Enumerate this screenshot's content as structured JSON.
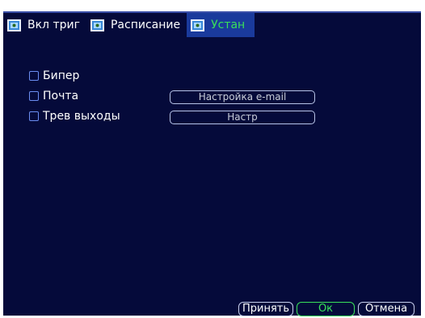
{
  "tabs": [
    {
      "label": "Вкл триг",
      "active": false,
      "icon": "settings-tab-icon"
    },
    {
      "label": "Расписание",
      "active": false,
      "icon": "schedule-tab-icon"
    },
    {
      "label": "Устан",
      "active": true,
      "icon": "setup-tab-icon"
    }
  ],
  "options": {
    "beeper": {
      "label": "Бипер",
      "checked": false
    },
    "mail": {
      "label": "Почта",
      "checked": false,
      "button": "Настройка e-mail"
    },
    "alarm_out": {
      "label": "Трев выходы",
      "checked": false,
      "button": "Настр"
    }
  },
  "footer": {
    "apply": "Принять",
    "ok": "Ок",
    "cancel": "Отмена"
  },
  "colors": {
    "background": "#050a3a",
    "active_tab": "#1a3a9c",
    "active_text": "#39e05a",
    "text": "#ffffff"
  }
}
